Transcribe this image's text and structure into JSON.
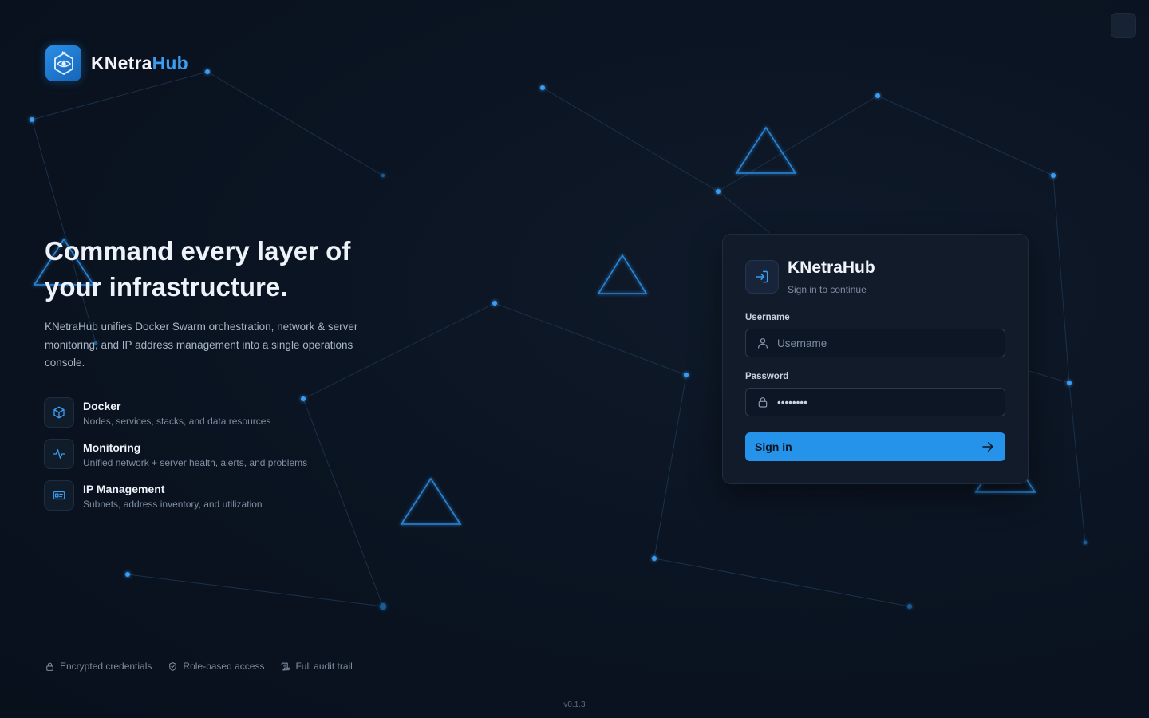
{
  "brand": {
    "name_part1": "KNetra",
    "name_part2": "Hub",
    "logo_icon": "eye-hex-icon",
    "accent_color": "#3b9cf0"
  },
  "hero": {
    "title": "Command every layer of your infrastructure.",
    "description": "KNetraHub unifies Docker Swarm orchestration, network & server monitoring, and IP address management into a single operations console."
  },
  "features": [
    {
      "title": "Docker",
      "subtitle": "Nodes, services, stacks, and data resources",
      "icon": "cube-icon"
    },
    {
      "title": "Monitoring",
      "subtitle": "Unified network + server health, alerts, and problems",
      "icon": "pulse-icon"
    },
    {
      "title": "IP Management",
      "subtitle": "Subnets, address inventory, and utilization",
      "icon": "id-card-icon"
    }
  ],
  "footer": {
    "badges": [
      {
        "label": "Encrypted credentials",
        "icon": "lock-icon"
      },
      {
        "label": "Role-based access",
        "icon": "shield-icon"
      },
      {
        "label": "Full audit trail",
        "icon": "scroll-icon"
      }
    ],
    "version": "v0.1.3"
  },
  "login": {
    "title": "KNetraHub",
    "subtitle": "Sign in to continue",
    "username_label": "Username",
    "username_placeholder": "Username",
    "username_value": "",
    "password_label": "Password",
    "password_value": "password",
    "submit_label": "Sign in",
    "button_color": "#2593ea"
  }
}
